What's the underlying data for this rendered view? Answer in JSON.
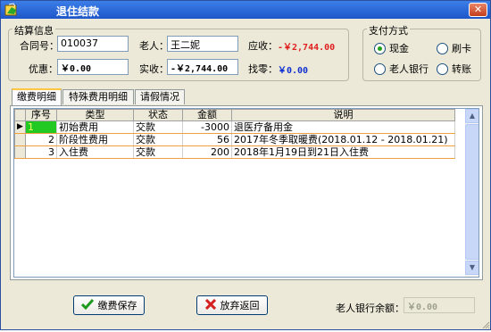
{
  "window": {
    "title": "退住结款",
    "close_symbol": "✕"
  },
  "settlement": {
    "legend": "结算信息",
    "contract_label": "合同号：",
    "contract_value": "010037",
    "elder_label": "老人：",
    "elder_value": "王二妮",
    "receivable_label": "应收：",
    "receivable_value": "-￥2,744.00",
    "discount_label": "优惠：",
    "discount_value": "￥0.00",
    "received_label": "实收：",
    "received_value": "-￥2,744.00",
    "change_label": "找零：",
    "change_value": "￥0.00"
  },
  "payment": {
    "legend": "支付方式",
    "options": [
      {
        "label": "现金",
        "selected": true
      },
      {
        "label": "刷卡",
        "selected": false
      },
      {
        "label": "老人银行",
        "selected": false
      },
      {
        "label": "转账",
        "selected": false
      }
    ]
  },
  "tabs": [
    {
      "label": "缴费明细",
      "active": true
    },
    {
      "label": "特殊费用明细",
      "active": false
    },
    {
      "label": "请假情况",
      "active": false
    }
  ],
  "table": {
    "columns": [
      "序号",
      "类型",
      "状态",
      "金额",
      "说明"
    ],
    "current_marker": "▶",
    "rows": [
      {
        "index": "1",
        "type": "初始费用",
        "status": "交款",
        "amount": "-3000",
        "note": "退医疗备用金"
      },
      {
        "index": "2",
        "type": "阶段性费用",
        "status": "交款",
        "amount": "56",
        "note": "2017年冬季取暖费(2018.01.12 - 2018.01.21)"
      },
      {
        "index": "3",
        "type": "入住费",
        "status": "交款",
        "amount": "200",
        "note": "2018年1月19日到21日入住费"
      }
    ]
  },
  "scrollbar": {
    "up_arrow": "▲",
    "down_arrow": "▼"
  },
  "footer": {
    "save_label": "缴费保存",
    "cancel_label": "放弃返回",
    "bank_balance_label": "老人银行余额：",
    "bank_balance_value": "￥0.00"
  },
  "colors": {
    "title_bar": "#2a63d4",
    "receivable_red": "#e02020",
    "change_blue": "#1030d0",
    "current_cell": "#22c922"
  },
  "icons": {
    "app": "app-icon",
    "save": "checkmark-icon",
    "cancel": "red-x-icon",
    "selector": "row-selector-icon"
  }
}
